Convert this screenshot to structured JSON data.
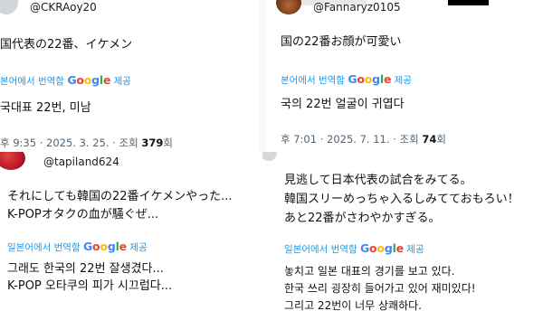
{
  "translate": {
    "ko_prefix_1": "본어에서 번역함",
    "ko_prefix_2": "본어에서 번역함",
    "ko_prefix_3": "일본어에서 번역함",
    "ko_prefix_4": "일본어에서 번역함",
    "provider": "Google",
    "suffix": "제공"
  },
  "cards": [
    {
      "handle": "@CKRAoy20",
      "text": [
        "国代表の22番、イケメン"
      ],
      "translation": [
        "국대표 22번, 미남"
      ],
      "meta_prefix": "후 9:35 · 2025. 3. 25. · 조회 ",
      "views": "379",
      "views_suffix": "회"
    },
    {
      "handle": "@Fannaryz0105",
      "text": [
        "国の22番お顔が可愛い"
      ],
      "translation": [
        "국의 22번 얼굴이 귀엽다"
      ],
      "meta_prefix": "후 7:01 · 2025. 7. 11. · 조회 ",
      "views": "74",
      "views_suffix": "회"
    },
    {
      "handle": "@tapiland624",
      "text": [
        "それにしても韓国の22番イケメンやった...",
        "K-POPオタクの血が騒ぐぜ..."
      ],
      "translation": [
        "그래도 한국의 22번 잘생겼다...",
        "K-POP 오타쿠의 피가 시끄럽다..."
      ]
    },
    {
      "handle": "",
      "text": [
        "見逃して日本代表の試合をみてる。",
        "韓国スリーめっちゃ入るしみてておもろい！",
        "あと22番がさわやかすぎる。"
      ],
      "translation": [
        "놓치고 일본 대표의 경기를 보고 있다.",
        "한국 쓰리 굉장히 들어가고 있어 재미있다!",
        "그리고 22번이 너무 상쾌하다."
      ]
    }
  ]
}
